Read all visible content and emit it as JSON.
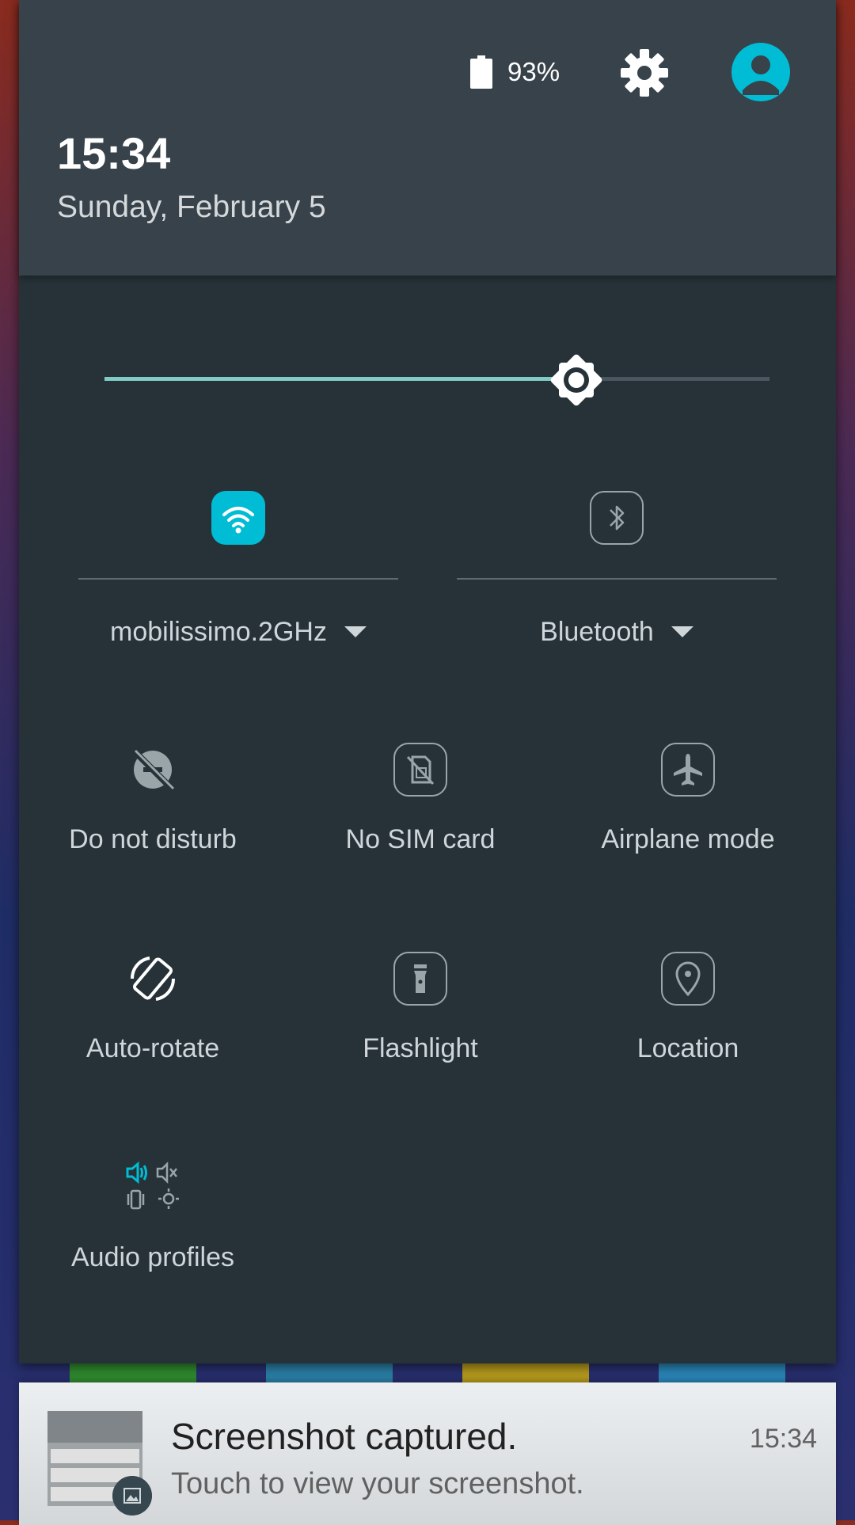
{
  "status": {
    "battery_text": "93%",
    "battery_level": 0.93,
    "icons": [
      "battery-icon",
      "gear-icon",
      "avatar-icon"
    ]
  },
  "header": {
    "time": "15:34",
    "date": "Sunday, February 5"
  },
  "brightness": {
    "level": 0.7,
    "accent_color": "#80cbc4"
  },
  "big_tiles": [
    {
      "label": "mobilissimo.2GHz",
      "icon": "wifi-icon",
      "active": true,
      "accent": "#00bcd4"
    },
    {
      "label": "Bluetooth",
      "icon": "bluetooth-icon",
      "active": false
    }
  ],
  "tiles": [
    {
      "label": "Do not disturb",
      "icon": "do-not-disturb-icon"
    },
    {
      "label": "No SIM card",
      "icon": "no-sim-icon"
    },
    {
      "label": "Airplane mode",
      "icon": "airplane-icon"
    },
    {
      "label": "Auto-rotate",
      "icon": "auto-rotate-icon"
    },
    {
      "label": "Flashlight",
      "icon": "flashlight-icon"
    },
    {
      "label": "Location",
      "icon": "location-icon"
    },
    {
      "label": "Audio profiles",
      "icon": "audio-profiles-icon"
    }
  ],
  "notification": {
    "title": "Screenshot captured.",
    "text": "Touch to view your screenshot.",
    "time": "15:34",
    "icon": "image-icon"
  }
}
